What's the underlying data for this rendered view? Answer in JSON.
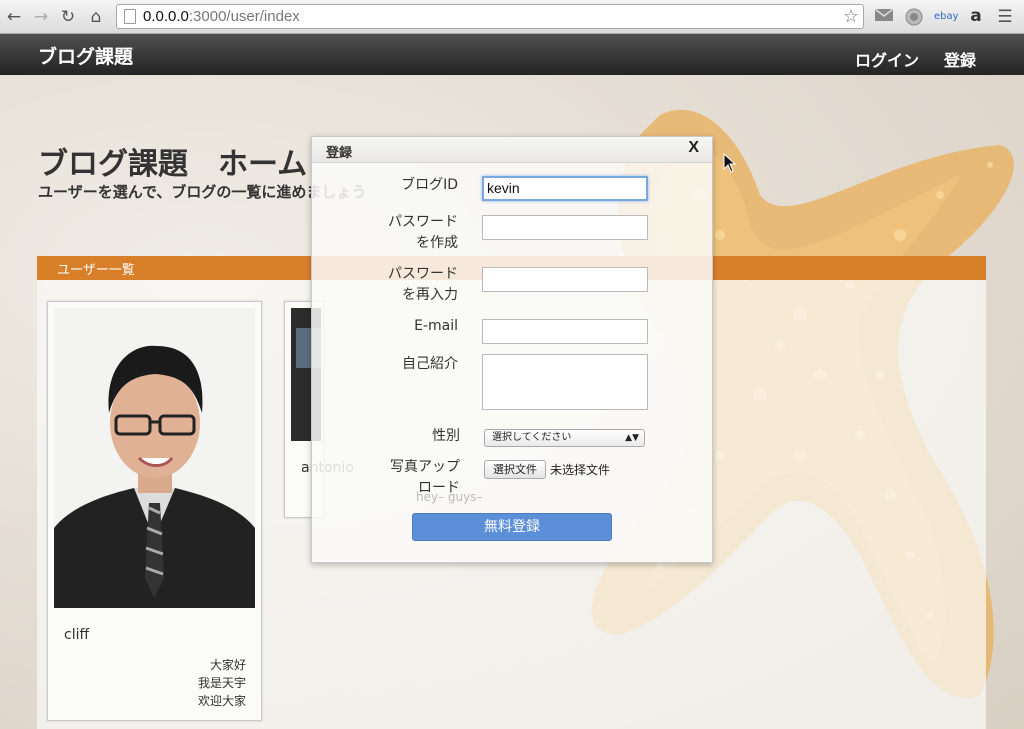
{
  "browser": {
    "url_host": "0.0.0.0",
    "url_path": ":3000/user/index",
    "extensions": [
      "mail-icon",
      "globe-icon",
      "ebay-icon",
      "amazon-icon",
      "menu-icon"
    ],
    "ebay_label": "ebay",
    "amazon_label": "a"
  },
  "header": {
    "brand": "ブログ課題",
    "login": "ログイン",
    "register": "登録"
  },
  "page": {
    "title": "ブログ課題　ホーム",
    "subtitle": "ユーザーを選んで、ブログの一覧に進めましょう",
    "users_heading": "ユーザー一覧"
  },
  "users": [
    {
      "name": "cliff",
      "bio": [
        "大家好",
        "我是天宇",
        "欢迎大家"
      ]
    },
    {
      "name": "antonio",
      "bio_ghost": "hey– guys–"
    }
  ],
  "modal": {
    "title": "登録",
    "close": "X",
    "fields": {
      "blog_id_label": "ブログID",
      "blog_id_value": "kevin",
      "password_label_1": "パスワード",
      "password_label_2": "を作成",
      "password_confirm_label_1": "パスワード",
      "password_confirm_label_2": "を再入力",
      "email_label": "E-mail",
      "bio_label": "自己紹介",
      "gender_label": "性別",
      "gender_selected": "選択してください",
      "photo_label_1": "写真アップ",
      "photo_label_2": "ロード",
      "file_button": "選択文件",
      "file_status": "未选择文件"
    },
    "submit": "無料登録"
  },
  "colors": {
    "header_dark": "#232323",
    "accent_orange": "#d87f2a",
    "submit_blue": "#5b8fd8"
  }
}
